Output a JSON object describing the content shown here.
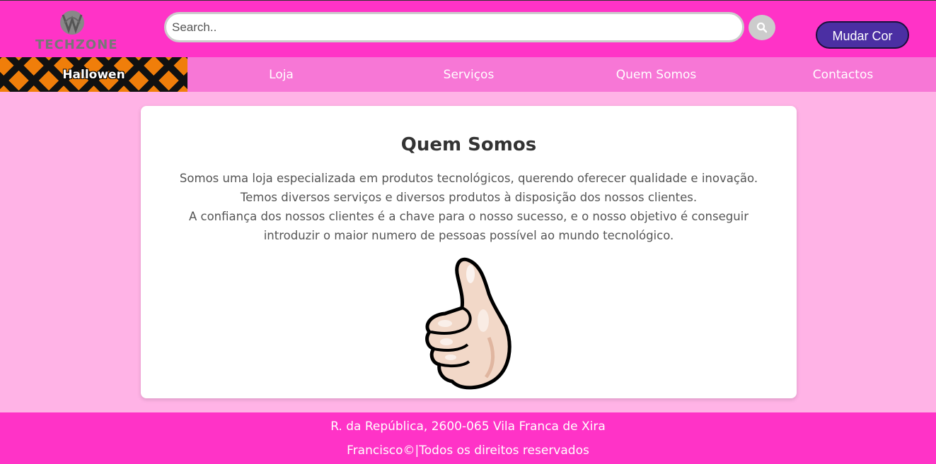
{
  "header": {
    "logo_text": "TECHZONE",
    "search_placeholder": "Search..",
    "search_button_icon": "search-icon",
    "color_button_label": "Mudar Cor"
  },
  "nav": {
    "items": [
      {
        "label": "Hallowen"
      },
      {
        "label": "Loja"
      },
      {
        "label": "Serviços"
      },
      {
        "label": "Quem Somos"
      },
      {
        "label": "Contactos"
      }
    ]
  },
  "main": {
    "title": "Quem Somos",
    "paragraph_lines": [
      "Somos uma loja especializada em produtos tecnológicos, querendo oferecer qualidade e inovação.",
      "Temos diversos serviços e diversos produtos à disposição dos nossos clientes.",
      "A confiança dos nossos clientes é a chave para o nosso sucesso, e o nosso objetivo é conseguir",
      "introduzir o maior numero de pessoas possível ao mundo tecnológico."
    ],
    "image_icon": "thumbs-up-icon"
  },
  "footer": {
    "address": "R. da República, 2600-065 Vila Franca de Xira",
    "copyright": "Francisco©|Todos os direitos reservados"
  },
  "colors": {
    "header_bg": "#ff33c7",
    "nav_bg": "#f777d6",
    "page_bg": "#ffb3e6",
    "button_bg": "#4b2fa3",
    "halloween_orange": "#f07e0a"
  }
}
